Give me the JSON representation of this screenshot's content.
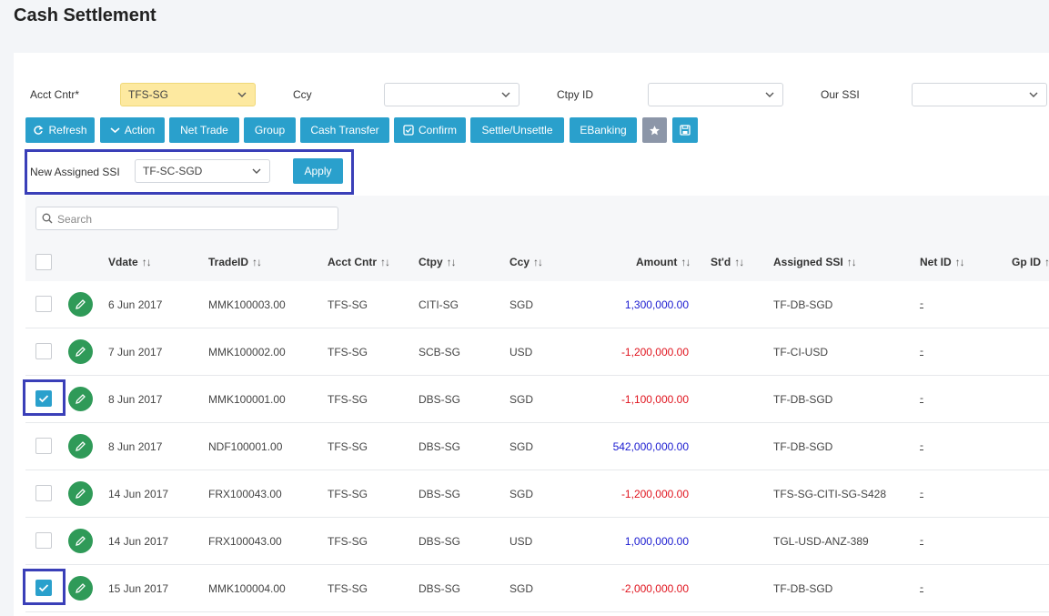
{
  "page": {
    "title": "Cash Settlement"
  },
  "filters": {
    "acct_cntr": {
      "label": "Acct Cntr*",
      "value": "TFS-SG"
    },
    "ccy": {
      "label": "Ccy",
      "value": ""
    },
    "ctpy_id": {
      "label": "Ctpy ID",
      "value": ""
    },
    "our_ssi": {
      "label": "Our SSI",
      "value": ""
    }
  },
  "toolbar": {
    "refresh": "Refresh",
    "action": "Action",
    "net_trade": "Net Trade",
    "group": "Group",
    "cash_transfer": "Cash Transfer",
    "confirm": "Confirm",
    "settle_unsettle": "Settle/Unsettle",
    "ebanking": "EBanking"
  },
  "assign": {
    "label": "New Assigned SSI",
    "value": "TF-SC-SGD",
    "apply": "Apply"
  },
  "search": {
    "placeholder": "Search"
  },
  "table": {
    "headers": {
      "vdate": "Vdate",
      "tradeid": "TradeID",
      "acct_cntr": "Acct Cntr",
      "ctpy": "Ctpy",
      "ccy": "Ccy",
      "amount": "Amount",
      "std": "St'd",
      "assigned_ssi": "Assigned SSI",
      "net_id": "Net ID",
      "gp_id": "Gp ID"
    },
    "sort_glyph": "↑↓",
    "rows": [
      {
        "checked": false,
        "vdate": "6 Jun 2017",
        "tradeid": "MMK100003.00",
        "acct": "TFS-SG",
        "ctpy": "CITI-SG",
        "ccy": "SGD",
        "amount": "1,300,000.00",
        "sign": "pos",
        "std": "",
        "ssi": "TF-DB-SGD",
        "netid": "-"
      },
      {
        "checked": false,
        "vdate": "7 Jun 2017",
        "tradeid": "MMK100002.00",
        "acct": "TFS-SG",
        "ctpy": "SCB-SG",
        "ccy": "USD",
        "amount": "-1,200,000.00",
        "sign": "neg",
        "std": "",
        "ssi": "TF-CI-USD",
        "netid": "-"
      },
      {
        "checked": true,
        "vdate": "8 Jun 2017",
        "tradeid": "MMK100001.00",
        "acct": "TFS-SG",
        "ctpy": "DBS-SG",
        "ccy": "SGD",
        "amount": "-1,100,000.00",
        "sign": "neg",
        "std": "",
        "ssi": "TF-DB-SGD",
        "netid": "-"
      },
      {
        "checked": false,
        "vdate": "8 Jun 2017",
        "tradeid": "NDF100001.00",
        "acct": "TFS-SG",
        "ctpy": "DBS-SG",
        "ccy": "SGD",
        "amount": "542,000,000.00",
        "sign": "pos",
        "std": "",
        "ssi": "TF-DB-SGD",
        "netid": "-"
      },
      {
        "checked": false,
        "vdate": "14 Jun 2017",
        "tradeid": "FRX100043.00",
        "acct": "TFS-SG",
        "ctpy": "DBS-SG",
        "ccy": "SGD",
        "amount": "-1,200,000.00",
        "sign": "neg",
        "std": "",
        "ssi": "TFS-SG-CITI-SG-S428",
        "netid": "-"
      },
      {
        "checked": false,
        "vdate": "14 Jun 2017",
        "tradeid": "FRX100043.00",
        "acct": "TFS-SG",
        "ctpy": "DBS-SG",
        "ccy": "USD",
        "amount": "1,000,000.00",
        "sign": "pos",
        "std": "",
        "ssi": "TGL-USD-ANZ-389",
        "netid": "-"
      },
      {
        "checked": true,
        "vdate": "15 Jun 2017",
        "tradeid": "MMK100004.00",
        "acct": "TFS-SG",
        "ctpy": "DBS-SG",
        "ccy": "SGD",
        "amount": "-2,000,000.00",
        "sign": "neg",
        "std": "",
        "ssi": "TF-DB-SGD",
        "netid": "-"
      }
    ]
  },
  "colors": {
    "primary": "#2aa0cc",
    "highlight": "#3a3fb8",
    "edit": "#2f9a58",
    "positive": "#1a1ad0",
    "negative": "#e0141e",
    "acct_bg": "#fde9a0"
  }
}
